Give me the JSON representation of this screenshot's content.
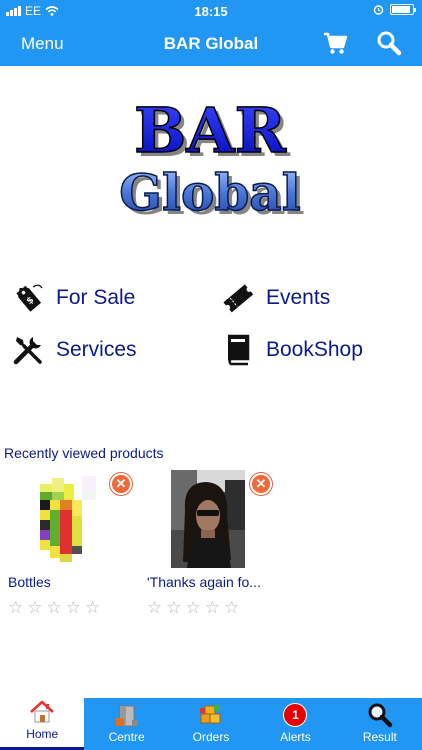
{
  "status_bar": {
    "carrier": "EE",
    "time": "18:15",
    "battery_level": 0.9
  },
  "nav": {
    "menu_label": "Menu",
    "title": "BAR Global",
    "cart_icon": "cart-icon",
    "search_icon": "search-icon"
  },
  "logo": {
    "line1": "BAR",
    "line2": "Global"
  },
  "categories": [
    {
      "label": "For Sale",
      "icon": "price-tag-icon"
    },
    {
      "label": "Events",
      "icon": "ticket-icon"
    },
    {
      "label": "Services",
      "icon": "tools-icon"
    },
    {
      "label": "BookShop",
      "icon": "book-icon"
    }
  ],
  "recent": {
    "title": "Recently viewed products",
    "products": [
      {
        "name": "Bottles",
        "rating": 0
      },
      {
        "name": "'Thanks again fo...",
        "rating": 0
      }
    ]
  },
  "tabs": [
    {
      "label": "Home",
      "icon": "home-icon",
      "active": true
    },
    {
      "label": "Centre",
      "icon": "centre-icon"
    },
    {
      "label": "Orders",
      "icon": "orders-icon"
    },
    {
      "label": "Alerts",
      "icon": "alerts-icon",
      "badge": "1"
    },
    {
      "label": "Result",
      "icon": "result-icon"
    }
  ],
  "colors": {
    "primary": "#2196f3",
    "text": "#0b1a8a",
    "remove": "#f0693a",
    "badge": "#e60000"
  }
}
